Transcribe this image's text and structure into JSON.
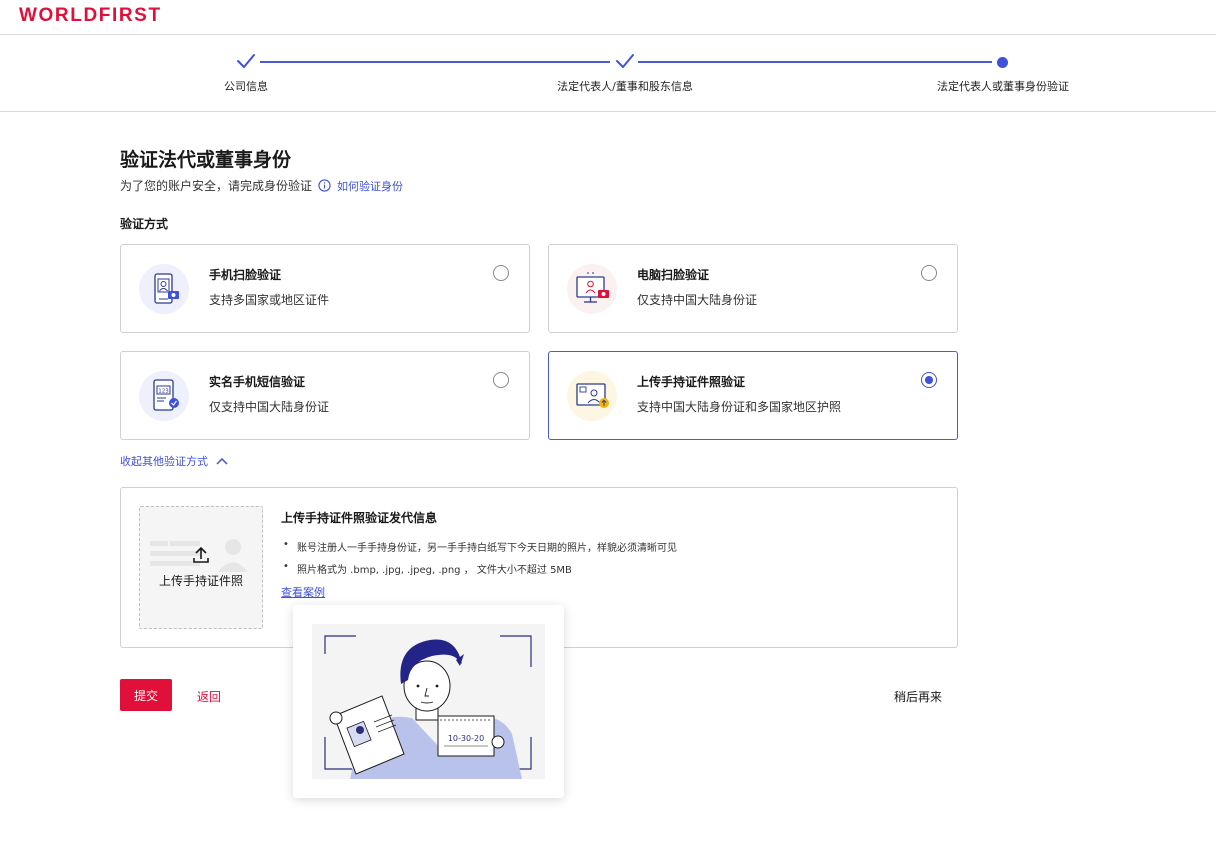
{
  "brand": {
    "logo_text": "WORLDFIRST",
    "accent": "#e0103a",
    "link_color": "#3f51d8"
  },
  "stepper": {
    "steps": [
      {
        "label": "公司信息",
        "status": "done"
      },
      {
        "label": "法定代表人/董事和股东信息",
        "status": "done"
      },
      {
        "label": "法定代表人或董事身份验证",
        "status": "current"
      }
    ]
  },
  "main": {
    "title": "验证法代或董事身份",
    "subtitle": "为了您的账户安全，请完成身份验证",
    "help_link": "如何验证身份",
    "method_label": "验证方式",
    "options": [
      {
        "title": "手机扫脸验证",
        "desc": "支持多国家或地区证件",
        "icon": "phone-face-scan-icon",
        "selected": false
      },
      {
        "title": "电脑扫脸验证",
        "desc": "仅支持中国大陆身份证",
        "icon": "computer-face-scan-icon",
        "selected": false
      },
      {
        "title": "实名手机短信验证",
        "desc": "仅支持中国大陆身份证",
        "icon": "phone-sms-icon",
        "selected": false
      },
      {
        "title": "上传手持证件照验证",
        "desc": "支持中国大陆身份证和多国家地区护照",
        "icon": "id-upload-icon",
        "selected": true
      }
    ],
    "collapse_link": "收起其他验证方式"
  },
  "upload": {
    "box_label": "上传手持证件照",
    "info_title": "上传手持证件照验证发代信息",
    "bullets": [
      "账号注册人一手手持身份证，另一手手持白纸写下今天日期的照片，样貌必须清晰可见",
      "照片格式为 .bmp, .jpg, .jpeg, .png ， 文件大小不超过 5MB"
    ],
    "example_link": "查看案例",
    "example_note": "10-30-20"
  },
  "actions": {
    "submit": "提交",
    "back": "返回",
    "later": "稍后再来"
  }
}
